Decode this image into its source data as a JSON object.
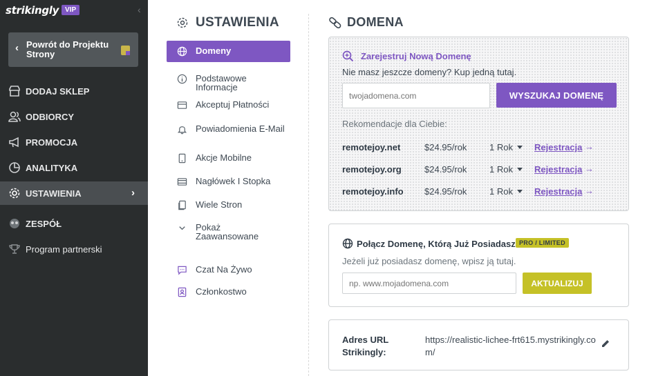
{
  "sidebar": {
    "brand": "strikingly",
    "vip_badge": "VIP",
    "back_button": "Powrót do Projektu Strony",
    "items": [
      {
        "label": "DODAJ SKLEP",
        "icon": "store-icon"
      },
      {
        "label": "ODBIORCY",
        "icon": "users-icon"
      },
      {
        "label": "PROMOCJA",
        "icon": "megaphone-icon"
      },
      {
        "label": "ANALITYKA",
        "icon": "pie-chart-icon"
      },
      {
        "label": "USTAWIENIA",
        "icon": "gear-icon",
        "active": true
      },
      {
        "label": "ZESPÓŁ",
        "icon": "team-icon"
      },
      {
        "label": "Program partnerski",
        "icon": "trophy-icon"
      }
    ]
  },
  "settings_menu": {
    "title": "USTAWIENIA",
    "items": [
      {
        "label": "Domeny",
        "icon": "globe-icon",
        "active": true
      },
      {
        "label": "Podstawowe Informacje",
        "icon": "info-icon"
      },
      {
        "label": "Akceptuj Płatności",
        "icon": "payment-icon"
      },
      {
        "label": "Powiadomienia E-Mail",
        "icon": "bell-icon"
      },
      {
        "label": "Akcje Mobilne",
        "icon": "mobile-icon"
      },
      {
        "label": "Nagłówek I Stopka",
        "icon": "header-footer-icon"
      },
      {
        "label": "Wiele Stron",
        "icon": "pages-icon"
      },
      {
        "label": "Pokaż Zaawansowane",
        "icon": "chevron-down-icon"
      },
      {
        "label": "Czat Na Żywo",
        "icon": "chat-icon"
      },
      {
        "label": "Członkostwo",
        "icon": "membership-icon"
      }
    ]
  },
  "domain": {
    "title": "DOMENA",
    "register": {
      "heading": "Zarejestruj Nową Domenę",
      "subtitle": "Nie masz jeszcze domeny? Kup jedną tutaj.",
      "placeholder": "twojadomena.com",
      "search_button": "WYSZUKAJ DOMENĘ",
      "recommendations_title": "Rekomendacje dla Ciebie:",
      "recommendations": [
        {
          "domain": "remotejoy.net",
          "price": "$24.95/rok",
          "period": "1 Rok",
          "action": "Rejestracja",
          "arrow": "→"
        },
        {
          "domain": "remotejoy.org",
          "price": "$24.95/rok",
          "period": "1 Rok",
          "action": "Rejestracja",
          "arrow": "→"
        },
        {
          "domain": "remotejoy.info",
          "price": "$24.95/rok",
          "period": "1 Rok",
          "action": "Rejestracja",
          "arrow": "→"
        }
      ]
    },
    "connect": {
      "heading": "Połącz Domenę, Którą Już Posiadasz",
      "badge": "PRO / LIMITED",
      "subtitle": "Jeżeli już posiadasz domenę, wpisz ją tutaj.",
      "placeholder": "np. www.mojadomena.com",
      "update_button": "AKTUALIZUJ"
    },
    "url": {
      "label": "Adres URL Strikingly:",
      "value": "https://realistic-lichee-frt615.mystrikingly.com/"
    }
  },
  "colors": {
    "accent": "#7e57c2",
    "pro": "#c5c127",
    "sidebar_bg": "#2a2d2e"
  }
}
